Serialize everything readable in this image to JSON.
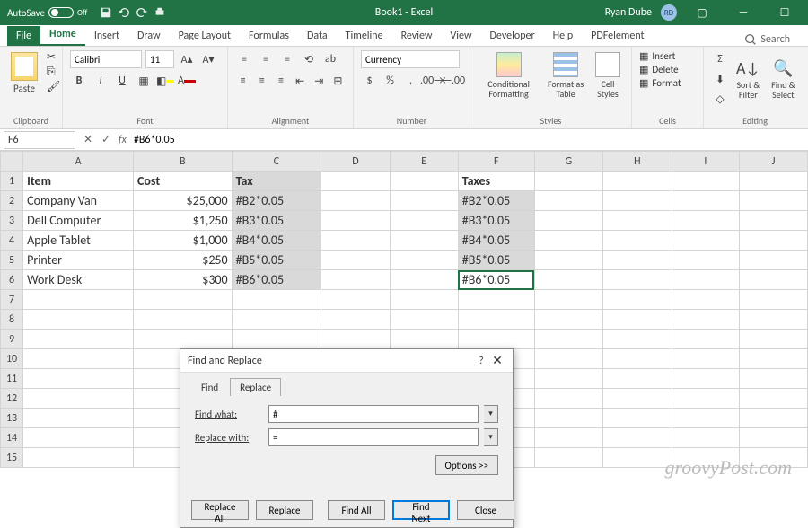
{
  "titlebar": {
    "autosave_label": "AutoSave",
    "autosave_state": "Off",
    "doc_title": "Book1 - Excel",
    "user_name": "Ryan Dube",
    "user_initials": "RD"
  },
  "tabs": {
    "file": "File",
    "items": [
      "Home",
      "Insert",
      "Draw",
      "Page Layout",
      "Formulas",
      "Data",
      "Timeline",
      "Review",
      "View",
      "Developer",
      "Help",
      "PDFelement"
    ],
    "active": "Home",
    "search": "Search"
  },
  "ribbon": {
    "clipboard": {
      "label": "Clipboard",
      "paste": "Paste"
    },
    "font": {
      "label": "Font",
      "name": "Calibri",
      "size": "11",
      "bold": "B",
      "italic": "I",
      "underline": "U"
    },
    "alignment": {
      "label": "Alignment"
    },
    "number": {
      "label": "Number",
      "format": "Currency"
    },
    "styles": {
      "label": "Styles",
      "cond": "Conditional Formatting",
      "table": "Format as Table",
      "cell": "Cell Styles"
    },
    "cells": {
      "label": "Cells",
      "insert": "Insert",
      "delete": "Delete",
      "format": "Format"
    },
    "editing": {
      "label": "Editing",
      "sort": "Sort & Filter",
      "find": "Find & Select"
    }
  },
  "formula_bar": {
    "cell_ref": "F6",
    "formula": "#B6*0.05"
  },
  "sheet": {
    "cols": [
      "A",
      "B",
      "C",
      "D",
      "E",
      "F",
      "G",
      "H",
      "I",
      "J"
    ],
    "headers": {
      "A": "Item",
      "B": "Cost",
      "C": "Tax",
      "F": "Taxes"
    },
    "rows": [
      {
        "n": "1"
      },
      {
        "n": "2",
        "A": "Company Van",
        "B": "$25,000",
        "C": "#B2*0.05",
        "F": "#B2*0.05"
      },
      {
        "n": "3",
        "A": "Dell Computer",
        "B": "$1,250",
        "C": "#B3*0.05",
        "F": "#B3*0.05"
      },
      {
        "n": "4",
        "A": "Apple Tablet",
        "B": "$1,000",
        "C": "#B4*0.05",
        "F": "#B4*0.05"
      },
      {
        "n": "5",
        "A": "Printer",
        "B": "$250",
        "C": "#B5*0.05",
        "F": "#B5*0.05"
      },
      {
        "n": "6",
        "A": "Work Desk",
        "B": "$300",
        "C": "#B6*0.05",
        "F": "#B6*0.05"
      }
    ]
  },
  "dialog": {
    "title": "Find and Replace",
    "tab_find": "Find",
    "tab_replace": "Replace",
    "find_label": "Find what:",
    "find_value": "#",
    "replace_label": "Replace with:",
    "replace_value": "=",
    "options": "Options >>",
    "replace_all": "Replace All",
    "replace": "Replace",
    "find_all": "Find All",
    "find_next": "Find Next",
    "close": "Close"
  },
  "watermark": "groovyPost.com"
}
